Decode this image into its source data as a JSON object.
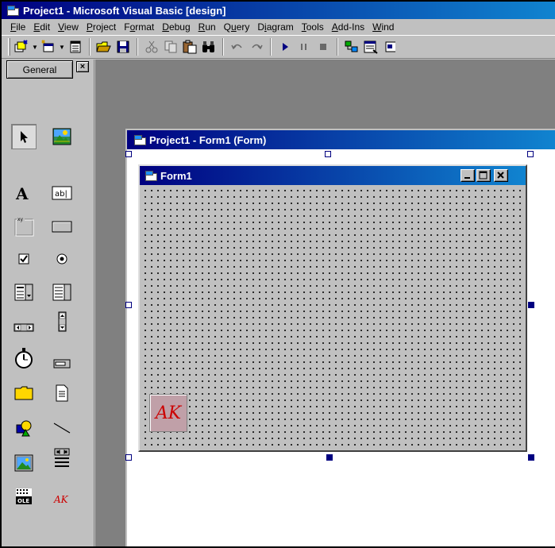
{
  "main_window": {
    "title": "Project1 - Microsoft Visual Basic [design]"
  },
  "menu": [
    {
      "pre": "",
      "u": "F",
      "post": "ile"
    },
    {
      "pre": "",
      "u": "E",
      "post": "dit"
    },
    {
      "pre": "",
      "u": "V",
      "post": "iew"
    },
    {
      "pre": "",
      "u": "P",
      "post": "roject"
    },
    {
      "pre": "F",
      "u": "o",
      "post": "rmat"
    },
    {
      "pre": "",
      "u": "D",
      "post": "ebug"
    },
    {
      "pre": "",
      "u": "R",
      "post": "un"
    },
    {
      "pre": "Q",
      "u": "u",
      "post": "ery"
    },
    {
      "pre": "D",
      "u": "i",
      "post": "agram"
    },
    {
      "pre": "",
      "u": "T",
      "post": "ools"
    },
    {
      "pre": "",
      "u": "A",
      "post": "dd-Ins"
    },
    {
      "pre": "",
      "u": "W",
      "post": "ind"
    }
  ],
  "toolbox": {
    "close_label": "×",
    "tab_label": "General",
    "tools": [
      "pointer",
      "picturebox",
      "label",
      "textbox",
      "frame",
      "commandbutton",
      "checkbox",
      "optionbutton",
      "combobox",
      "listbox",
      "hscrollbar",
      "vscrollbar",
      "timer",
      "drivelistbox",
      "dirlistbox",
      "filelistbox",
      "shape",
      "line",
      "image",
      "data",
      "ole",
      "ak-control"
    ]
  },
  "designer": {
    "title": "Project1 - Form1 (Form)"
  },
  "form1": {
    "title": "Form1",
    "ak_label": "AK"
  },
  "colors": {
    "titlebar_start": "#000080",
    "titlebar_end": "#1084d0",
    "face": "#c0c0c0",
    "ak_text": "#cc0000"
  }
}
